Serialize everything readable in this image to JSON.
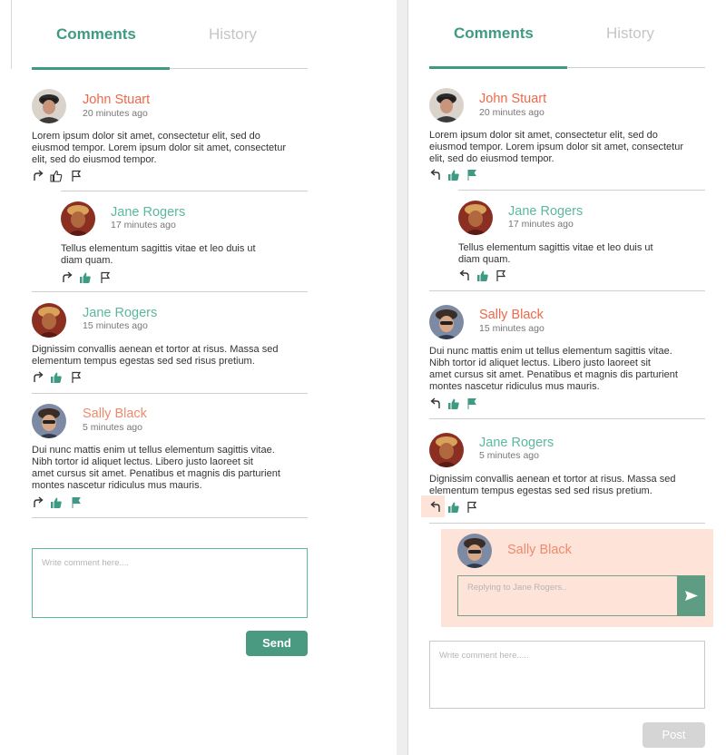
{
  "colors": {
    "accent": "#3f9a83",
    "name_orange": "#f0674a",
    "name_teal": "#5bb89e",
    "highlight": "#fde3d8",
    "post_disabled": "#d5d5d5"
  },
  "left": {
    "tabs": {
      "active": "Comments",
      "inactive": "History"
    },
    "comments": [
      {
        "author": "John Stuart",
        "time": "20 minutes ago",
        "lines": [
          "Lorem ipsum dolor sit amet, consectetur elit, sed do",
          "eiusmod tempor. Lorem ipsum dolor sit amet, consectetur",
          "elit, sed do eiusmod tempor."
        ]
      },
      {
        "author": "Jane Rogers",
        "time": "17 minutes ago",
        "lines": [
          "Tellus elementum sagittis vitae et leo duis ut",
          "diam quam."
        ]
      },
      {
        "author": "Jane Rogers",
        "time": "15 minutes ago",
        "lines": [
          "Dignissim convallis aenean et tortor at risus. Massa sed",
          "elementum tempus egestas sed sed risus pretium."
        ]
      },
      {
        "author": "Sally Black",
        "time": "5 minutes ago",
        "lines": [
          "Dui nunc mattis enim ut tellus elementum sagittis vitae.",
          "Nibh tortor id aliquet lectus. Libero justo laoreet sit",
          "amet cursus sit amet. Penatibus et magnis dis parturient",
          "montes nascetur ridiculus mus mauris."
        ]
      }
    ],
    "composer": {
      "placeholder": "Write comment here....",
      "button": "Send"
    }
  },
  "right": {
    "tabs": {
      "active": "Comments",
      "inactive": "History"
    },
    "comments": [
      {
        "author": "John Stuart",
        "time": "20 minutes ago",
        "lines": [
          "Lorem ipsum dolor sit amet, consectetur elit, sed do",
          "eiusmod tempor. Lorem ipsum dolor sit amet, consectetur",
          "elit, sed do eiusmod tempor."
        ]
      },
      {
        "author": "Jane Rogers",
        "time": "17 minutes ago",
        "lines": [
          "Tellus elementum sagittis vitae et leo duis ut",
          "diam quam."
        ]
      },
      {
        "author": "Sally Black",
        "time": "15 minutes ago",
        "lines": [
          "Dui nunc mattis enim ut tellus elementum sagittis vitae.",
          "Nibh tortor id aliquet lectus. Libero justo laoreet sit",
          "amet cursus sit amet. Penatibus et magnis dis parturient",
          "montes nascetur ridiculus mus mauris."
        ]
      },
      {
        "author": "Jane Rogers",
        "time": "5 minutes ago",
        "lines": [
          "Dignissim convallis aenean et tortor at risus. Massa sed",
          "elementum tempus egestas sed sed risus pretium."
        ]
      }
    ],
    "reply": {
      "author": "Sally Black",
      "placeholder": "Replying to Jane Rogers.."
    },
    "composer": {
      "placeholder": "Write comment here.....",
      "button": "Post"
    }
  }
}
